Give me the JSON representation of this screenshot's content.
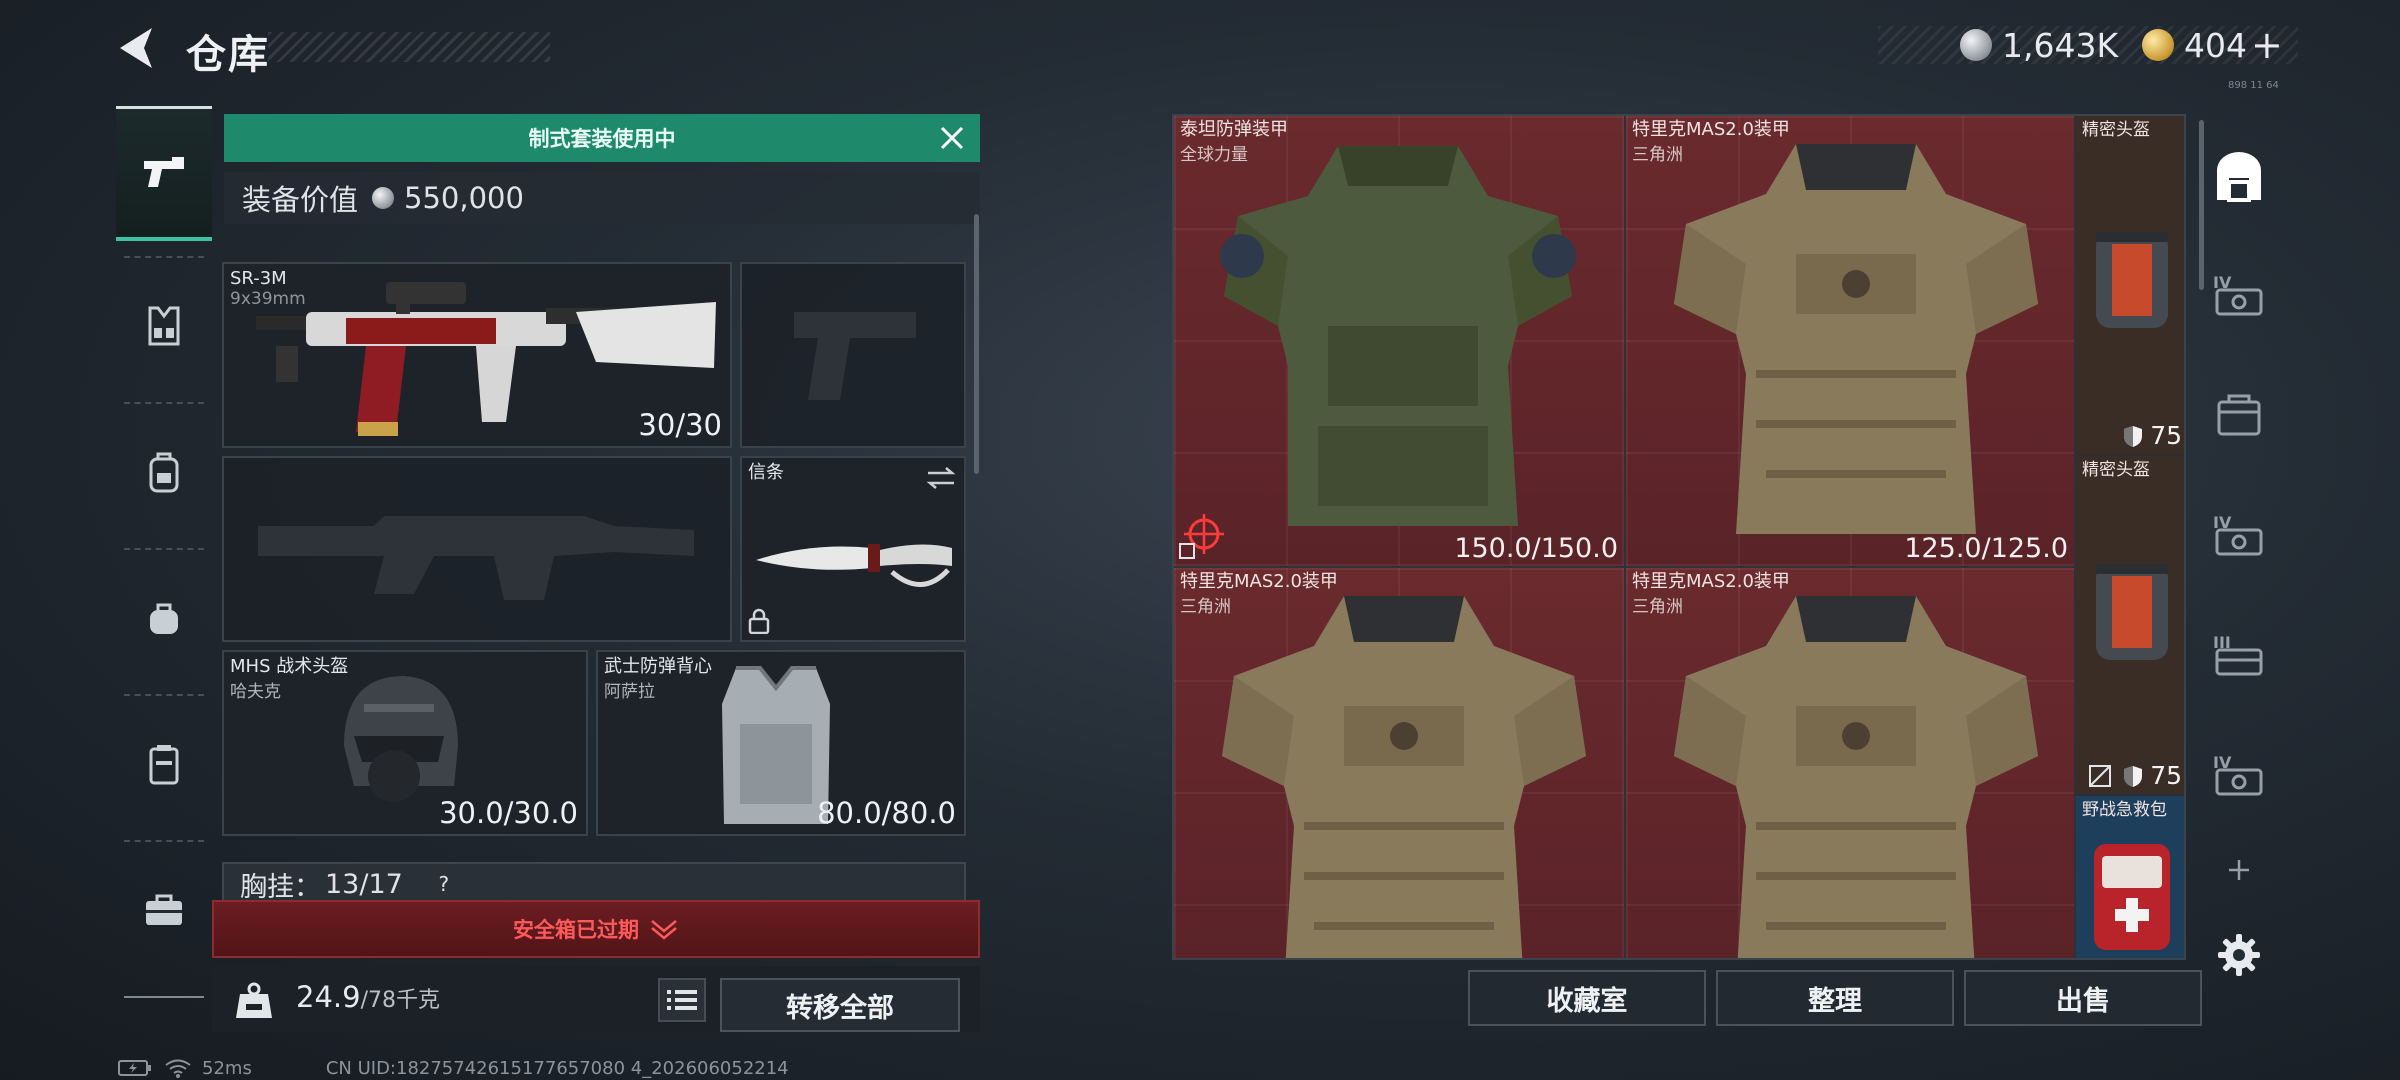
{
  "header": {
    "title": "仓库",
    "currency": [
      {
        "name": "coin-silver",
        "value": "1,643K"
      },
      {
        "name": "coin-gold",
        "value": "404"
      }
    ],
    "plus": "+",
    "version_mark": "898 11 64"
  },
  "left_nav": {
    "items": [
      {
        "icon": "pistol-icon",
        "active": true
      },
      {
        "icon": "chest-rig-icon",
        "active": false
      },
      {
        "icon": "backpack-icon",
        "active": false
      },
      {
        "icon": "bag-icon",
        "active": false
      },
      {
        "icon": "case-icon",
        "active": false
      },
      {
        "icon": "toolbox-icon",
        "active": false
      }
    ]
  },
  "loadout": {
    "banner": "制式套装使用中",
    "value_label": "装备价值",
    "value": "550,000",
    "primary": {
      "name": "SR-3M",
      "ammo": "9x39mm",
      "count": "30/30"
    },
    "melee": {
      "name": "信条"
    },
    "helmet": {
      "name": "MHS 战术头盔",
      "sub": "哈夫克",
      "durability": "30.0/30.0"
    },
    "armor": {
      "name": "武士防弹背心",
      "sub": "阿萨拉",
      "durability": "80.0/80.0"
    },
    "chest": {
      "label": "胸挂：",
      "count": "13/17",
      "help": "?"
    },
    "safebox": "安全箱已过期",
    "weight": {
      "value": "24.9",
      "max": "/78千克"
    },
    "transfer_all": "转移全部"
  },
  "storage": {
    "items": [
      {
        "name": "泰坦防弹装甲",
        "sub": "全球力量",
        "durability": "150.0/150.0"
      },
      {
        "name": "特里克MAS2.0装甲",
        "sub": "三角洲",
        "durability": "125.0/125.0"
      },
      {
        "name": "特里克MAS2.0装甲",
        "sub": "三角洲",
        "durability": ""
      },
      {
        "name": "特里克MAS2.0装甲",
        "sub": "三角洲",
        "durability": ""
      }
    ],
    "side_items": [
      {
        "name": "精密头盔",
        "value": "75"
      },
      {
        "name": "精密头盔",
        "value": "75"
      },
      {
        "name": "野战急救包"
      }
    ],
    "actions": [
      "收藏室",
      "整理",
      "出售"
    ]
  },
  "right_nav": {
    "items": [
      "home-icon",
      "tier-iv-case-icon",
      "crate-icon",
      "tier-iv-case-icon",
      "tier-iii-crate-icon",
      "tier-iv-case-icon",
      "add-icon"
    ],
    "tiers": [
      "IV",
      "",
      "IV",
      "III",
      "IV"
    ]
  },
  "status": {
    "ping": "52ms",
    "uid": "CN UID:18275742615177657080 4_202606052214"
  },
  "colors": {
    "accent_green": "#1f8a6b",
    "warning_red": "#ff5a5a",
    "card_red": "#6a2a2e"
  }
}
